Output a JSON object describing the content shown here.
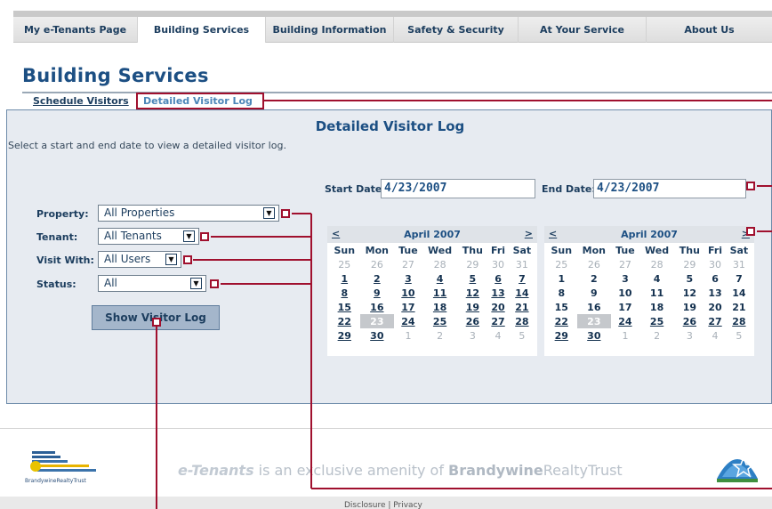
{
  "nav": {
    "tabs": [
      {
        "label": "My e-Tenants Page"
      },
      {
        "label": "Building Services"
      },
      {
        "label": "Building Information"
      },
      {
        "label": "Safety & Security"
      },
      {
        "label": "At Your Service"
      },
      {
        "label": "About Us"
      }
    ],
    "active_tab": "Building Services"
  },
  "page": {
    "title": "Building Services",
    "subtabs": [
      {
        "label": "Schedule Visitors"
      },
      {
        "label": "Detailed Visitor Log"
      }
    ],
    "active_subtab": "Detailed Visitor Log"
  },
  "panel": {
    "title": "Detailed Visitor Log",
    "instructions": "Select a start and end date to view a detailed visitor log."
  },
  "filters": {
    "property": {
      "label": "Property:",
      "value": "All Properties"
    },
    "tenant": {
      "label": "Tenant:",
      "value": "All Tenants"
    },
    "visit_with": {
      "label": "Visit With:",
      "value": "All Users"
    },
    "status": {
      "label": "Status:",
      "value": "All"
    }
  },
  "dates": {
    "start_label": "Start Date:",
    "start_value": "4/23/2007",
    "end_label": "End Date:",
    "end_value": "4/23/2007"
  },
  "calendar": {
    "month_title": "April 2007",
    "prev": "<",
    "next": ">",
    "weekdays": [
      "Sun",
      "Mon",
      "Tue",
      "Wed",
      "Thu",
      "Fri",
      "Sat"
    ],
    "weeks": [
      [
        "25",
        "26",
        "27",
        "28",
        "29",
        "30",
        "31"
      ],
      [
        "1",
        "2",
        "3",
        "4",
        "5",
        "6",
        "7"
      ],
      [
        "8",
        "9",
        "10",
        "11",
        "12",
        "13",
        "14"
      ],
      [
        "15",
        "16",
        "17",
        "18",
        "19",
        "20",
        "21"
      ],
      [
        "22",
        "23",
        "24",
        "25",
        "26",
        "27",
        "28"
      ],
      [
        "29",
        "30",
        "1",
        "2",
        "3",
        "4",
        "5"
      ]
    ],
    "selected_day": "23"
  },
  "show_button": "Show Visitor Log",
  "footer": {
    "logo_text": "BrandywineRealtyTrust",
    "tagline_brand": "e-Tenants",
    "tagline_mid": " is an exclusive amenity of ",
    "tagline_company_bold": "Brandywine",
    "tagline_company_rest": "RealtyTrust",
    "links": "Disclosure | Privacy"
  },
  "colors": {
    "brand_blue": "#1c4f83",
    "panel_bg": "#e7ebf1",
    "annotation_red": "#a0102e",
    "selected_day_bg": "#c5c8cc"
  },
  "icons": {
    "dropdown": "triangle-down",
    "logo": "brandywine-logo",
    "badge": "energy-star"
  }
}
